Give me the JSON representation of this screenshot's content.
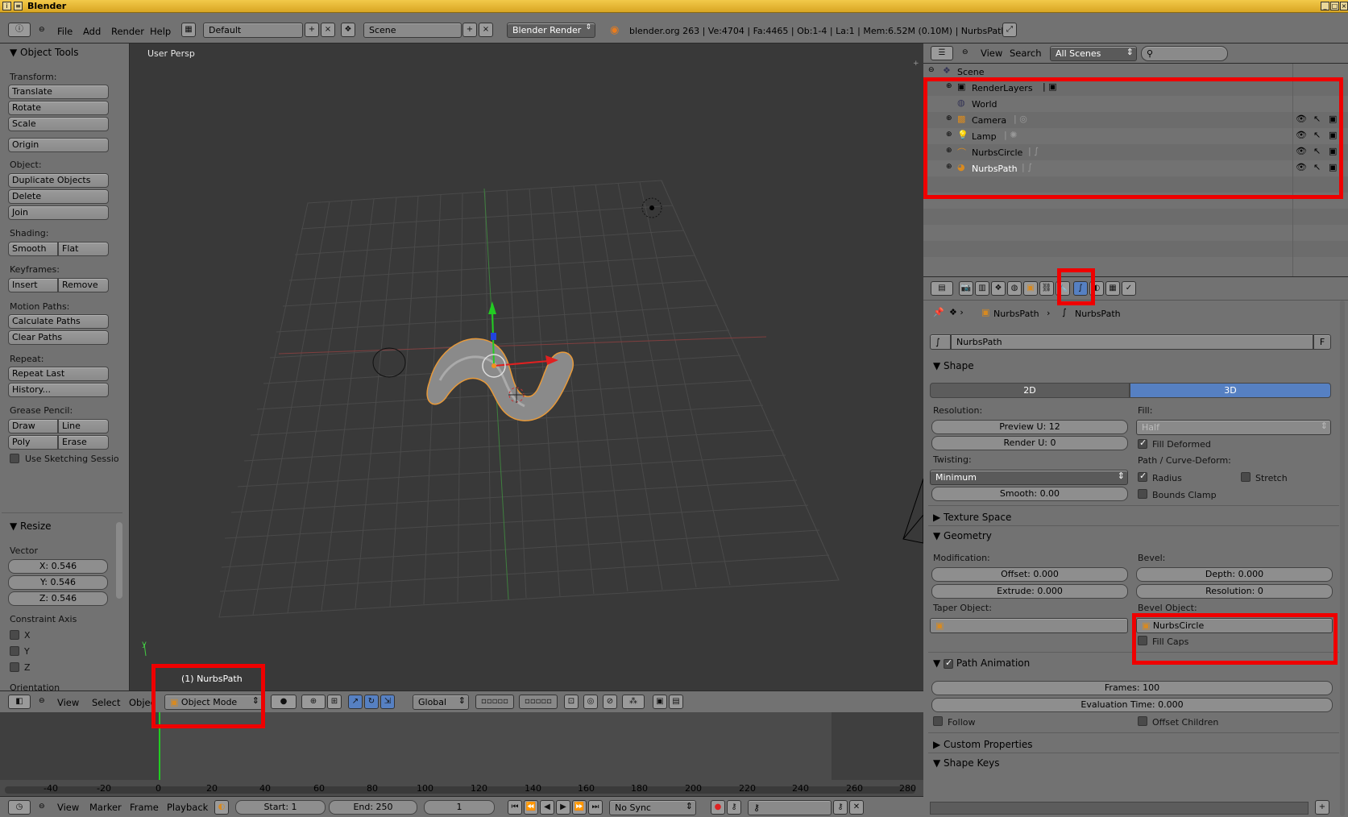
{
  "window": {
    "title": "Blender"
  },
  "top_header": {
    "menus": [
      "File",
      "Add",
      "Render",
      "Help"
    ],
    "screen_layout": "Default",
    "scene": "Scene",
    "render_engine": "Blender Render",
    "stats": "blender.org 263 | Ve:4704 | Fa:4465 | Ob:1-4 | La:1 | Mem:6.52M (0.10M) | NurbsPath"
  },
  "tool_shelf": {
    "title": "Object Tools",
    "transform_label": "Transform:",
    "translate": "Translate",
    "rotate": "Rotate",
    "scale": "Scale",
    "origin": "Origin",
    "object_label": "Object:",
    "duplicate": "Duplicate Objects",
    "delete": "Delete",
    "join": "Join",
    "shading_label": "Shading:",
    "smooth": "Smooth",
    "flat": "Flat",
    "keyframes_label": "Keyframes:",
    "insert": "Insert",
    "remove": "Remove",
    "motion_label": "Motion Paths:",
    "calc_paths": "Calculate Paths",
    "clear_paths": "Clear Paths",
    "repeat_label": "Repeat:",
    "repeat_last": "Repeat Last",
    "history": "History...",
    "grease_label": "Grease Pencil:",
    "draw": "Draw",
    "line": "Line",
    "poly": "Poly",
    "erase": "Erase",
    "sketching": "Use Sketching Sessio",
    "resize_title": "Resize",
    "vector_label": "Vector",
    "vx": "X: 0.546",
    "vy": "Y: 0.546",
    "vz": "Z: 0.546",
    "constraint_label": "Constraint Axis",
    "cx": "X",
    "cy": "Y",
    "cz": "Z",
    "orientation_label": "Orientation"
  },
  "viewport": {
    "view_label": "User Persp",
    "object_label": "(1) NurbsPath",
    "axis_y_label": "y"
  },
  "view3d_header": {
    "view": "View",
    "select": "Select",
    "object": "Objec",
    "mode": "Object Mode",
    "orientation": "Global"
  },
  "timeline": {
    "ruler": [
      "-40",
      "-20",
      "0",
      "20",
      "40",
      "60",
      "80",
      "100",
      "120",
      "140",
      "160",
      "180",
      "200",
      "220",
      "240",
      "260",
      "280"
    ],
    "menus": [
      "View",
      "Marker",
      "Frame",
      "Playback"
    ],
    "start": "Start: 1",
    "end": "End: 250",
    "current": "1",
    "sync": "No Sync"
  },
  "outliner": {
    "menus": [
      "View",
      "Search"
    ],
    "filter": "All Scenes",
    "scene": "Scene",
    "items": [
      "RenderLayers",
      "World",
      "Camera",
      "Lamp",
      "NurbsCircle",
      "NurbsPath"
    ]
  },
  "properties": {
    "breadcrumb_object": "NurbsPath",
    "breadcrumb_data": "NurbsPath",
    "datablock_name": "NurbsPath",
    "datablock_fake": "F",
    "shape_title": "Shape",
    "tab_2d": "2D",
    "tab_3d": "3D",
    "resolution_label": "Resolution:",
    "preview_u": "Preview U: 12",
    "render_u": "Render U: 0",
    "fill_label": "Fill:",
    "fill_value": "Half",
    "fill_deformed": "Fill Deformed",
    "twisting_label": "Twisting:",
    "twist_value": "Minimum",
    "smooth": "Smooth: 0.00",
    "path_deform_label": "Path / Curve-Deform:",
    "radius": "Radius",
    "stretch": "Stretch",
    "bounds_clamp": "Bounds Clamp",
    "texture_space": "Texture Space",
    "geometry_title": "Geometry",
    "modification_label": "Modification:",
    "offset": "Offset: 0.000",
    "extrude": "Extrude: 0.000",
    "bevel_label": "Bevel:",
    "depth": "Depth: 0.000",
    "resolution": "Resolution: 0",
    "taper_label": "Taper Object:",
    "bevel_obj_label": "Bevel Object:",
    "bevel_obj": "NurbsCircle",
    "fill_caps": "Fill Caps",
    "path_anim_title": "Path Animation",
    "frames": "Frames: 100",
    "eval_time": "Evaluation Time: 0.000",
    "follow": "Follow",
    "offset_children": "Offset Children",
    "custom_props": "Custom Properties",
    "shape_keys": "Shape Keys"
  },
  "colors": {
    "highlight": "#ef0000",
    "selected_tab": "#5680c2",
    "title_bar": "#e5b737"
  }
}
